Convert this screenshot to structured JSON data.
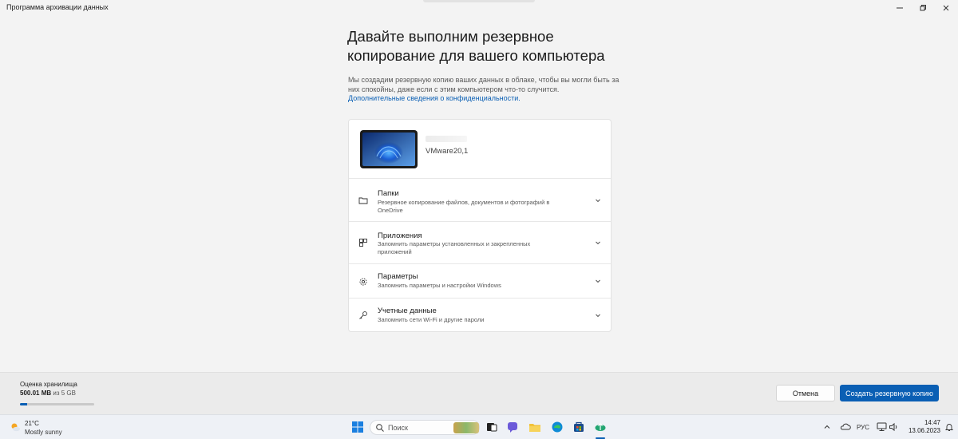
{
  "window": {
    "title": "Программа архивации данных",
    "min_icon": "minimize-icon",
    "max_icon": "maximize-icon",
    "close_icon": "close-icon"
  },
  "main": {
    "heading": "Давайте выполним резервное копирование для вашего компьютера",
    "description": "Мы создадим резервную копию ваших данных в облаке, чтобы вы могли быть за них спокойны, даже если с этим компьютером что-то случится.",
    "privacy_link": "Дополнительные сведения о конфиденциальности."
  },
  "device": {
    "name": "VMware20,1",
    "image_icon": "windows-wallpaper-thumbnail"
  },
  "items": [
    {
      "title": "Папки",
      "subtitle": "Резервное копирование файлов, документов и фотографий в OneDrive",
      "icon": "folder-icon"
    },
    {
      "title": "Приложения",
      "subtitle": "Запомнить параметры установленных и закрепленных приложений",
      "icon": "apps-icon"
    },
    {
      "title": "Параметры",
      "subtitle": "Запомнить параметры и настройки Windows",
      "icon": "gear-icon"
    },
    {
      "title": "Учетные данные",
      "subtitle": "Запомнить сети Wi-Fi и другие пароли",
      "icon": "key-icon"
    }
  ],
  "footer": {
    "storage_label": "Оценка хранилища",
    "storage_used": "500.01 MB",
    "storage_total": "из 5 GB",
    "storage_fraction": 0.1,
    "cancel_label": "Отмена",
    "primary_label": "Создать резервную копию"
  },
  "taskbar": {
    "weather_temp": "21°C",
    "weather_desc": "Mostly sunny",
    "search_placeholder": "Поиск",
    "language": "РУС",
    "time": "14:47",
    "date": "13.06.2023"
  },
  "colors": {
    "accent": "#0a5fb4",
    "background": "#f3f3f3"
  }
}
